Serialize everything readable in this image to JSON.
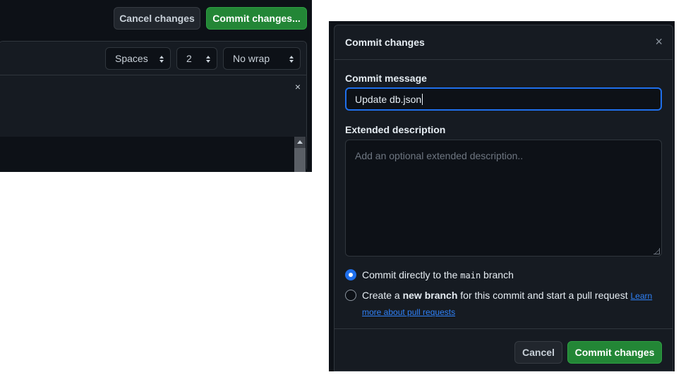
{
  "toolbar": {
    "cancel_label": "Cancel changes",
    "commit_label": "Commit changes..."
  },
  "editor": {
    "indent_mode": "Spaces",
    "indent_size": "2",
    "wrap_mode": "No wrap",
    "notice_close": "×"
  },
  "dialog": {
    "title": "Commit changes",
    "close": "×",
    "message_label": "Commit message",
    "message_value": "Update db.json",
    "description_label": "Extended description",
    "description_placeholder": "Add an optional extended description..",
    "option_direct": {
      "prefix": "Commit directly to the ",
      "branch": "main",
      "suffix": " branch",
      "selected": true
    },
    "option_new": {
      "prefix": "Create a ",
      "bold": "new branch",
      "suffix": " for this commit and start a pull request ",
      "link": "Learn more about pull requests",
      "selected": false
    },
    "cancel_label": "Cancel",
    "commit_label": "Commit changes"
  },
  "colors": {
    "accent": "#1f6feb",
    "primary_button": "#238636",
    "link": "#2f81f7"
  }
}
